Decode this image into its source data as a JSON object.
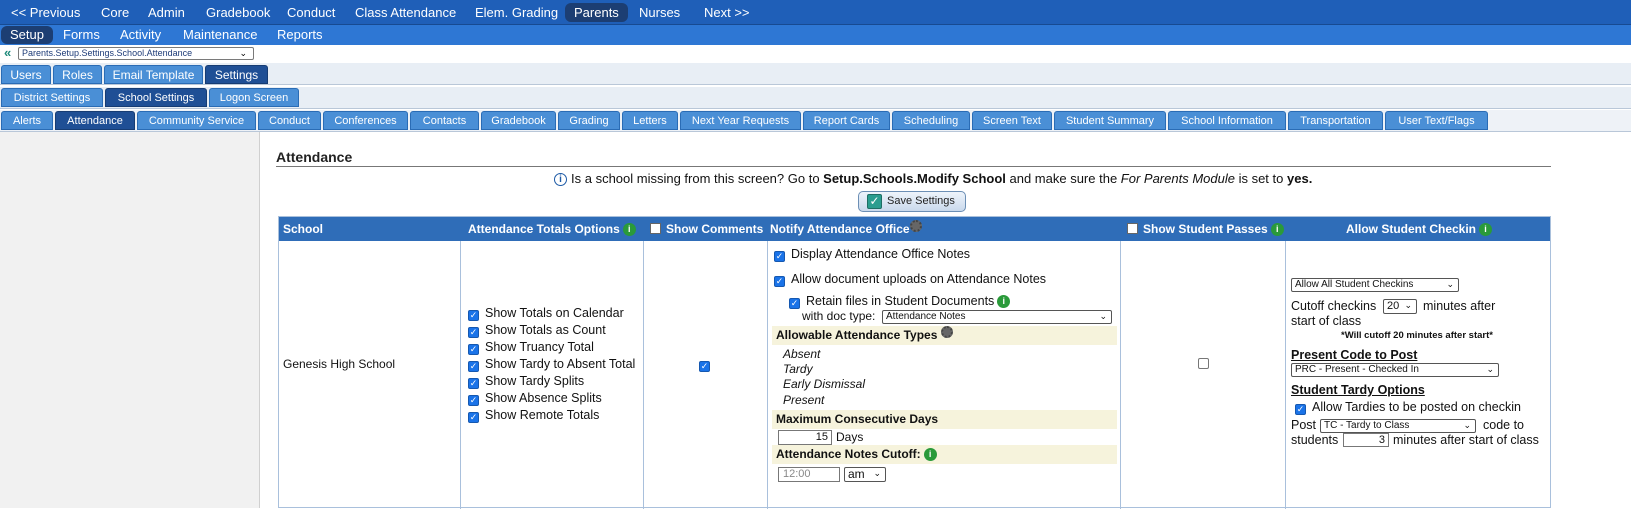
{
  "nav": {
    "top": [
      "<< Previous",
      "Core",
      "Admin",
      "Gradebook",
      "Conduct",
      "Class Attendance",
      "Elem. Grading",
      "Parents",
      "Nurses",
      "Next >>"
    ],
    "sub": [
      "Setup",
      "Forms",
      "Activity",
      "Maintenance",
      "Reports"
    ]
  },
  "breadcrumb": {
    "back": "«",
    "value": "Parents.Setup.Settings.School.Attendance"
  },
  "tabs1": [
    "Users",
    "Roles",
    "Email Template",
    "Settings"
  ],
  "tabs2": [
    "District Settings",
    "School Settings",
    "Logon Screen"
  ],
  "tabs3": [
    "Alerts",
    "Attendance",
    "Community Service",
    "Conduct",
    "Conferences",
    "Contacts",
    "Gradebook",
    "Grading",
    "Letters",
    "Next Year Requests",
    "Report Cards",
    "Scheduling",
    "Screen Text",
    "Student Summary",
    "School Information",
    "Transportation",
    "User Text/Flags"
  ],
  "section": {
    "title": "Attendance",
    "info_pre": "Is a school missing from this screen? Go to ",
    "info_b1": "Setup.Schools.Modify School",
    "info_mid": " and make sure the ",
    "info_i": "For Parents Module",
    "info_post": " is set to ",
    "info_b2": "yes.",
    "save_label": "Save Settings"
  },
  "table": {
    "headers": {
      "school": "School",
      "totals": "Attendance Totals Options",
      "comments": "Show Comments",
      "notify": "Notify Attendance Office",
      "passes": "Show Student Passes",
      "checkin": "Allow Student Checkin"
    },
    "school_name": "Genesis High School",
    "totals_options": [
      "Show Totals on Calendar",
      "Show Totals as Count",
      "Show Truancy Total",
      "Show Tardy to Absent Total",
      "Show Tardy Splits",
      "Show Absence Splits",
      "Show Remote Totals"
    ],
    "notify": {
      "display_notes": "Display Attendance Office Notes",
      "allow_uploads": "Allow document uploads on Attendance Notes",
      "retain_files": "Retain files in Student Documents",
      "with_doc_type": "with doc type:",
      "doc_type_value": "Attendance Notes",
      "allowable_types": "Allowable Attendance Types",
      "types": [
        "Absent",
        "Tardy",
        "Early Dismissal",
        "Present"
      ],
      "max_days_label": "Maximum Consecutive Days",
      "max_days_value": "15",
      "days_unit": "Days",
      "cutoff_label": "Attendance Notes Cutoff:",
      "cutoff_placeholder": "12:00",
      "ampm": "am"
    },
    "checkin": {
      "mode": "Allow All Student Checkins",
      "cutoff_pre": "Cutoff checkins",
      "cutoff_value": "20",
      "cutoff_post": "minutes after",
      "cutoff_post2": "start of class",
      "cutoff_note": "*Will cutoff 20 minutes after start*",
      "present_code_label": "Present Code to Post",
      "present_code_value": "PRC - Present - Checked In",
      "tardy_options_label": "Student Tardy Options",
      "allow_tardies": "Allow Tardies to be posted on checkin",
      "post_label": "Post",
      "tardy_code_value": "TC - Tardy to Class",
      "code_to": "code to",
      "students_label": "students",
      "students_minutes": "3",
      "minutes_after": "minutes after start of class"
    }
  }
}
